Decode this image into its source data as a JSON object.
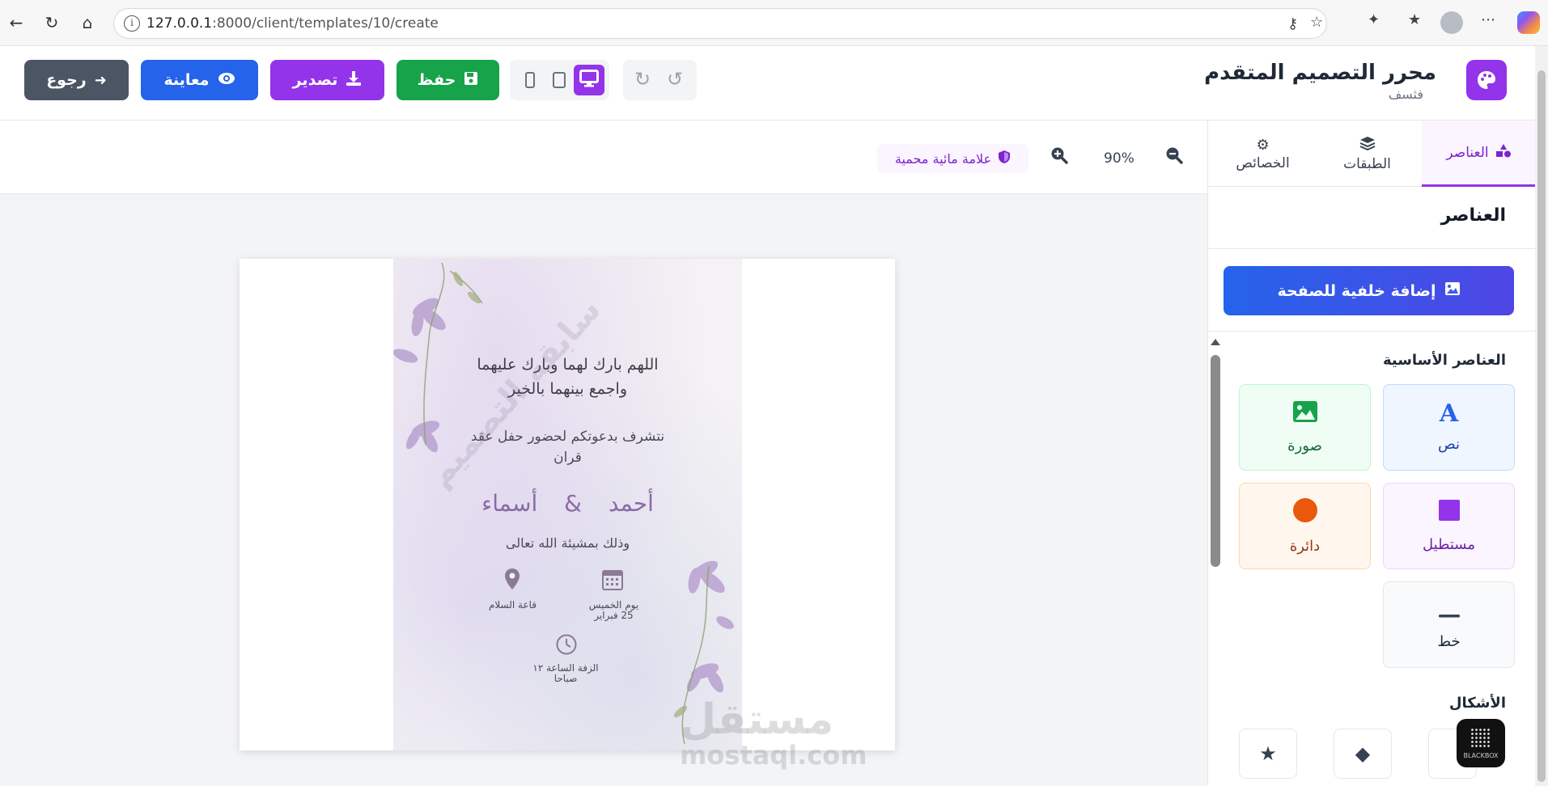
{
  "browser": {
    "url_host": "127.0.0.1",
    "url_rest": ":8000/client/templates/10/create"
  },
  "header": {
    "title": "محرر التصميم المتقدم",
    "subtitle": "فثسف",
    "buttons": {
      "back": "رجوع",
      "preview": "معاينة",
      "export": "تصدير",
      "save": "حفظ"
    },
    "active_device": "desktop"
  },
  "toolbar": {
    "zoom_level": "90%",
    "watermark_badge": "علامة مائية محمية"
  },
  "card": {
    "dua_line1": "اللهم بارك لهما وبارك عليهما",
    "dua_line2": "واجمع بينهما بالخير",
    "invite_line1": "نتشرف بدعوتكم لحضور حفل عقد",
    "invite_line2": "قران",
    "bride": "أسماء",
    "ampersand": "&",
    "groom": "أحمد",
    "will_of_god": "وذلك بمشيئة الله تعالى",
    "venue": "قاعة السلام",
    "date_line1": "يوم الخميس",
    "date_line2": "25 فبراير",
    "time_line1": "الزفة الساعة ١٢",
    "time_line2": "صباحا",
    "diagonal_watermark": "سابقة التصميم"
  },
  "overlay": {
    "mostaql_ar": "مستقل",
    "mostaql_en": "mostaql.com",
    "blackbox": "BLACKBOX"
  },
  "panel": {
    "tabs": [
      {
        "label": "العناصر",
        "icon": "shapes-icon",
        "active": true
      },
      {
        "label": "الطبقات",
        "icon": "layers-icon",
        "active": false
      },
      {
        "label": "الخصائص",
        "icon": "gear-icon",
        "active": false
      }
    ],
    "title": "العناصر",
    "add_background": "إضافة خلفية للصفحة",
    "basic_elements_title": "العناصر الأساسية",
    "elements": {
      "text": "نص",
      "image": "صورة",
      "rectangle": "مستطيل",
      "circle": "دائرة",
      "line": "خط"
    },
    "shapes_title": "الأشكال"
  },
  "colors": {
    "accent": "#9333ea",
    "primary": "#2563eb",
    "success": "#16a34a",
    "neutral": "#4b5563",
    "card_name": "#8b6aa6"
  }
}
